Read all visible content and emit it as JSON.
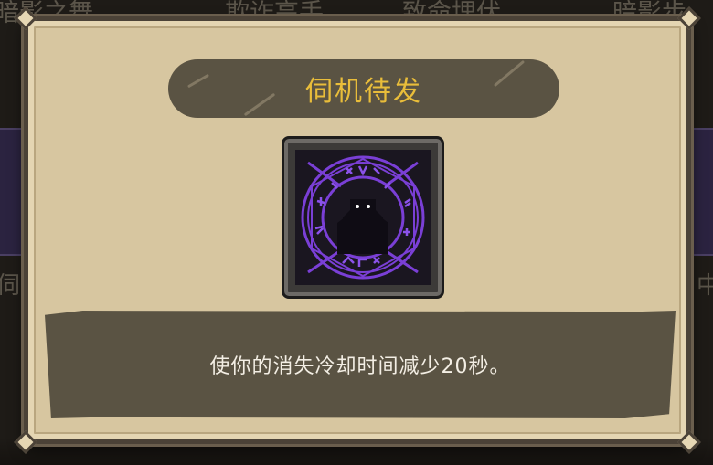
{
  "background": {
    "tabs": [
      "暗影之舞",
      "欺诈高手",
      "致命埋伏",
      "暗影步"
    ],
    "side_left": "伺",
    "side_right": "中"
  },
  "dialog": {
    "title": "伺机待发",
    "skill_icon": "shadow-rune-circle-icon",
    "description": "使你的消失冷却时间减少20秒。"
  },
  "colors": {
    "title_gold": "#e9bd3a",
    "panel_dark": "#5a5343",
    "parchment": "#d7c6a0",
    "rune_purple": "#7a3fd6"
  }
}
